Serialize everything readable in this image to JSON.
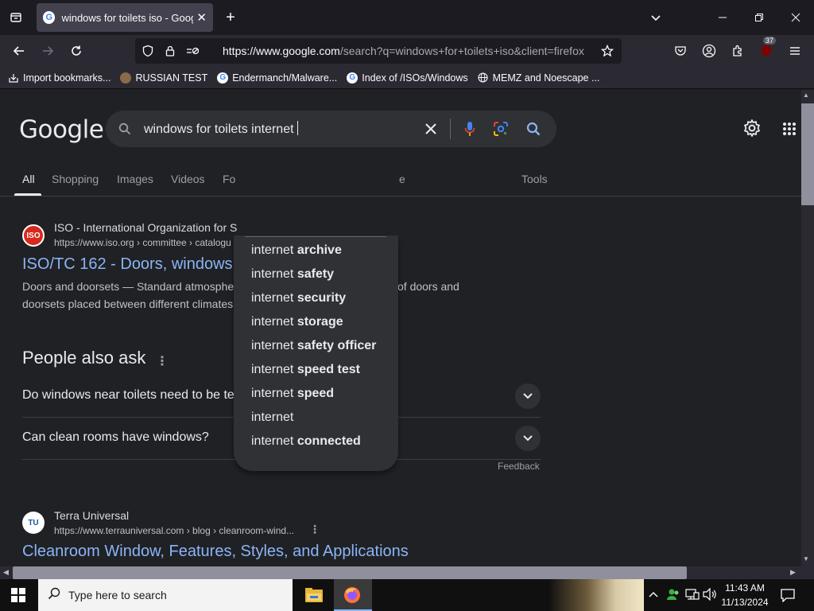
{
  "browser": {
    "tab_title": "windows for toilets iso - Google",
    "tab_favicon": "G",
    "url_host": "https://www.google.com",
    "url_path": "/search?q=windows+for+toilets+iso&client=firefox",
    "extension_badge": "37"
  },
  "bookmarks": [
    {
      "label": "Import bookmarks...",
      "icon": "import-icon"
    },
    {
      "label": "RUSSIAN TEST",
      "icon": "bookmark-favicon"
    },
    {
      "label": "Endermanch/Malware...",
      "icon": "google-favicon"
    },
    {
      "label": "Index of /ISOs/Windows",
      "icon": "google-favicon"
    },
    {
      "label": "MEMZ and Noescape ...",
      "icon": "globe-icon"
    }
  ],
  "google": {
    "logo": "Google",
    "query": "windows for toilets internet",
    "tabs": [
      "All",
      "Shopping",
      "Images",
      "Videos",
      "Fo",
      "e",
      "Tools"
    ],
    "suggestions": [
      {
        "prefix": "internet ",
        "bold": "archive"
      },
      {
        "prefix": "internet ",
        "bold": "safety"
      },
      {
        "prefix": "internet ",
        "bold": "security"
      },
      {
        "prefix": "internet ",
        "bold": "storage"
      },
      {
        "prefix": "internet ",
        "bold": "safety officer"
      },
      {
        "prefix": "internet ",
        "bold": "speed test"
      },
      {
        "prefix": "internet ",
        "bold": "speed"
      },
      {
        "prefix": "internet",
        "bold": ""
      },
      {
        "prefix": "internet ",
        "bold": "connected"
      }
    ],
    "result1": {
      "site": "ISO - International Organization for S",
      "url": "https://www.iso.org › committee › catalogu",
      "title": "ISO/TC 162 - Doors, windows",
      "snippet_line1": "Doors and doorsets — Standard atmosphe",
      "snippet_line1_end": "of doors and",
      "snippet_line2": "doorsets placed between different climates",
      "icon_text": "ISO"
    },
    "paa": {
      "title": "People also ask",
      "questions": [
        "Do windows near toilets need to be tempered?",
        "Can clean rooms have windows?"
      ],
      "feedback": "Feedback"
    },
    "result2": {
      "site": "Terra Universal",
      "url": "https://www.terrauniversal.com › blog › cleanroom-wind...",
      "title": "Cleanroom Window, Features, Styles, and Applications",
      "icon_text": "TU"
    }
  },
  "taskbar": {
    "search_placeholder": "Type here to search",
    "time": "11:43 AM",
    "date": "11/13/2024"
  },
  "colors": {
    "link": "#8ab4f8",
    "page_bg": "#202124",
    "iso_red": "#d9281c"
  }
}
